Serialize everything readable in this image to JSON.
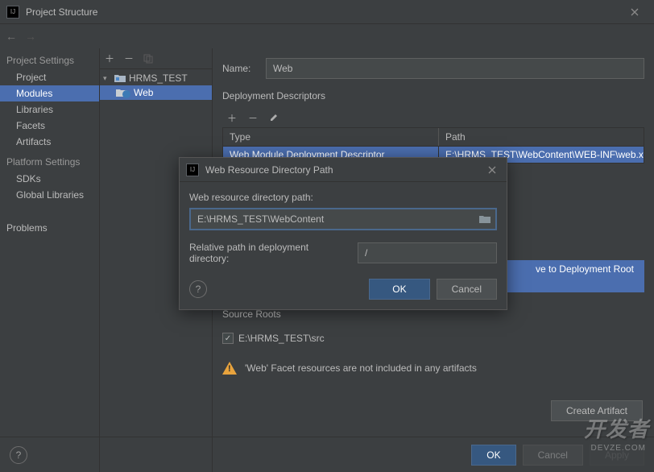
{
  "window": {
    "title": "Project Structure"
  },
  "sidebar": {
    "heading1": "Project Settings",
    "items1": [
      "Project",
      "Modules",
      "Libraries",
      "Facets",
      "Artifacts"
    ],
    "selectedIndex1": 1,
    "heading2": "Platform Settings",
    "items2": [
      "SDKs",
      "Global Libraries"
    ],
    "problems": "Problems"
  },
  "tree": {
    "module": "HRMS_TEST",
    "facet": "Web"
  },
  "form": {
    "nameLabel": "Name:",
    "nameValue": "Web",
    "deploymentSection": "Deployment Descriptors",
    "table": {
      "col1": "Type",
      "col2": "Path",
      "row1": {
        "type": "Web Module Deployment Descriptor",
        "path": "E:\\HRMS_TEST\\WebContent\\WEB-INF\\web.xml"
      }
    },
    "relativeAction": "ve to Deployment Root",
    "sourceRootsSection": "Source Roots",
    "sourceRoot": "E:\\HRMS_TEST\\src",
    "warning": "'Web' Facet resources are not included in any artifacts",
    "createArtifact": "Create Artifact"
  },
  "dialog": {
    "title": "Web Resource Directory Path",
    "label1": "Web resource directory path:",
    "input1": "E:\\HRMS_TEST\\WebContent",
    "label2": "Relative path in deployment directory:",
    "input2": "/",
    "ok": "OK",
    "cancel": "Cancel"
  },
  "bottom": {
    "ok": "OK",
    "cancel": "Cancel",
    "apply": "Apply"
  },
  "watermark": {
    "main": "开发者",
    "sub": "DEVZE.COM"
  }
}
